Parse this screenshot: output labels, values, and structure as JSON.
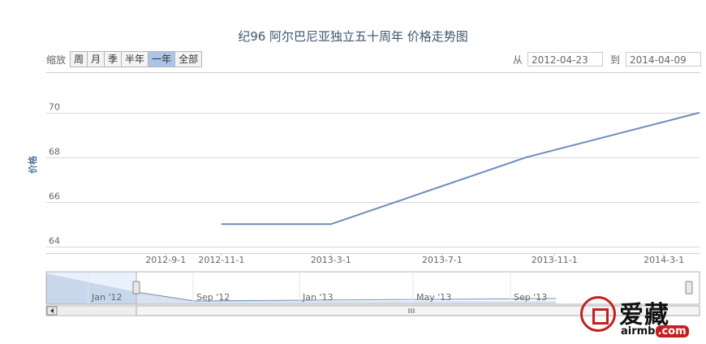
{
  "title": "纪96 阿尔巴尼亚独立五十周年  价格走势图",
  "range_selector": {
    "label": "缩放",
    "buttons": [
      "周",
      "月",
      "季",
      "半年",
      "一年",
      "全部"
    ],
    "selected": "一年",
    "from_label": "从",
    "from_value": "2012-04-23",
    "to_label": "到",
    "to_value": "2014-04-09"
  },
  "chart_data": {
    "type": "line",
    "ylabel": "价格",
    "y_ticks": [
      64,
      66,
      68,
      70
    ],
    "ylim": [
      63.7,
      71.6
    ],
    "x_ticks": [
      "2012-9-1",
      "2012-11-1",
      "2013-3-1",
      "2013-7-1",
      "2013-11-1",
      "2014-3-1"
    ],
    "xlim": [
      "2012-04-23",
      "2014-04-09"
    ],
    "series": [
      {
        "x": [
          "2012-11-01",
          "2013-03-01",
          "2013-10-01",
          "2014-04-09"
        ],
        "values": [
          65,
          65,
          68,
          70
        ],
        "color": "#6b8dba"
      }
    ],
    "grid": true
  },
  "navigator": {
    "labels": [
      "Jan '12",
      "Sep '12",
      "Jan '13",
      "May '13",
      "Sep '13"
    ]
  },
  "watermark": {
    "text": "爱藏",
    "url": "airmb",
    "url_suffix": ".com"
  },
  "colors": {
    "line": "#6b8dba",
    "grid": "#d8d8d8",
    "title": "#3e576f",
    "navigator_fill": "#6b8dba"
  }
}
